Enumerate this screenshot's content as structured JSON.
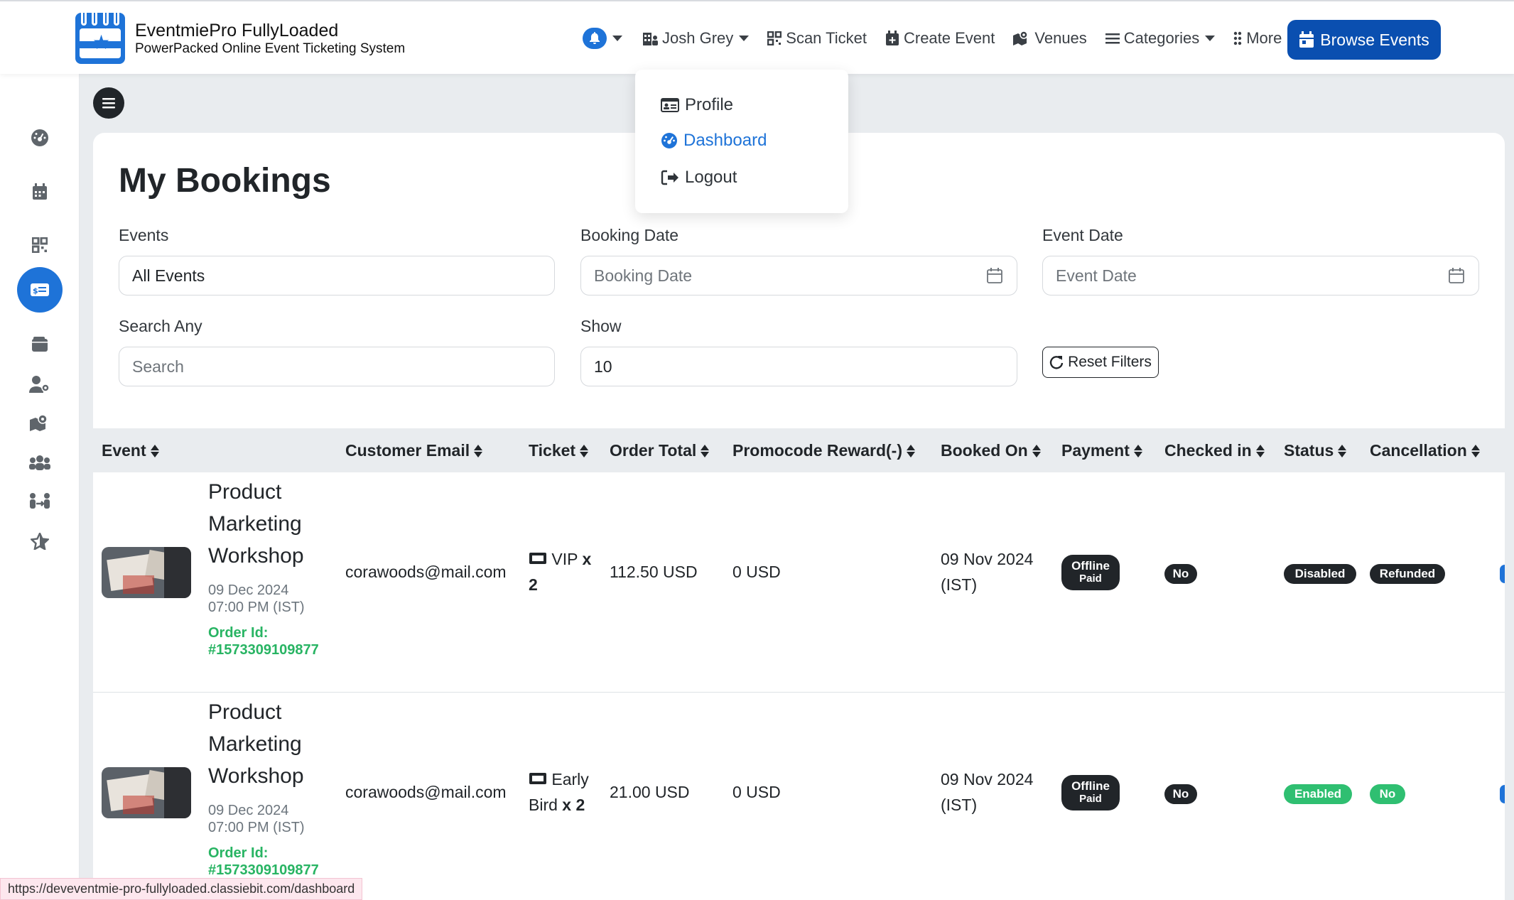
{
  "brand": {
    "title": "EventmiePro FullyLoaded",
    "subtitle": "PowerPacked Online Event Ticketing System"
  },
  "nav": {
    "user": "Josh Grey",
    "scan_ticket": "Scan Ticket",
    "create_event": "Create Event",
    "venues": "Venues",
    "categories": "Categories",
    "more": "More",
    "browse_events": "Browse Events"
  },
  "dropdown": {
    "items": [
      {
        "label": "Profile",
        "icon": "profile-card-icon"
      },
      {
        "label": "Dashboard",
        "icon": "dashboard-gauge-icon",
        "active": true
      },
      {
        "label": "Logout",
        "icon": "logout-icon"
      }
    ]
  },
  "sidebar": {
    "icons": [
      "dashboard-icon",
      "calendar-icon",
      "qr-icon",
      "bookings-ticket-icon",
      "wallet-icon",
      "user-gear-icon",
      "map-icon",
      "people-icon",
      "attendees-icon",
      "star-icon"
    ],
    "active_index": 3
  },
  "page": {
    "title": "My Bookings"
  },
  "filters": {
    "events_label": "Events",
    "events_value": "All Events",
    "booking_date_label": "Booking Date",
    "booking_date_placeholder": "Booking Date",
    "event_date_label": "Event Date",
    "event_date_placeholder": "Event Date",
    "search_label": "Search Any",
    "search_placeholder": "Search",
    "show_label": "Show",
    "show_value": "10",
    "reset_label": "Reset Filters"
  },
  "table": {
    "headers": [
      "Event",
      "Customer Email",
      "Ticket",
      "Order Total",
      "Promocode Reward(-)",
      "Booked On",
      "Payment",
      "Checked in",
      "Status",
      "Cancellation"
    ],
    "rows": [
      {
        "event_title": "Product Marketing Workshop",
        "event_date": "09 Dec 2024",
        "event_time": "07:00 PM (IST)",
        "order_label": "Order Id:",
        "order_id": "#1573309109877",
        "email": "corawoods@mail.com",
        "ticket_name": "VIP",
        "ticket_qty": "x 2",
        "order_total": "112.50 USD",
        "promocode": "0 USD",
        "booked_on_date": "09 Nov 2024",
        "booked_on_tz": "(IST)",
        "payment_line1": "Offline",
        "payment_line2": "Paid",
        "checked_in": "No",
        "status": "Disabled",
        "cancellation": "Refunded"
      },
      {
        "event_title": "Product Marketing Workshop",
        "event_date": "09 Dec 2024",
        "event_time": "07:00 PM (IST)",
        "order_label": "Order Id:",
        "order_id": "#1573309109877",
        "email": "corawoods@mail.com",
        "ticket_name": "Early Bird",
        "ticket_qty": "x 2",
        "order_total": "21.00 USD",
        "promocode": "0 USD",
        "booked_on_date": "09 Nov 2024",
        "booked_on_tz": "(IST)",
        "payment_line1": "Offline",
        "payment_line2": "Paid",
        "checked_in": "No",
        "status": "Enabled",
        "cancellation": "No"
      }
    ]
  },
  "statusbar": {
    "url": "https://deveventmie-pro-fullyloaded.classiebit.com/dashboard"
  },
  "colors": {
    "primary": "#1e73d8",
    "browse_button": "#0a4fb0",
    "success": "#2fbf71",
    "dark_badge": "#212529"
  }
}
